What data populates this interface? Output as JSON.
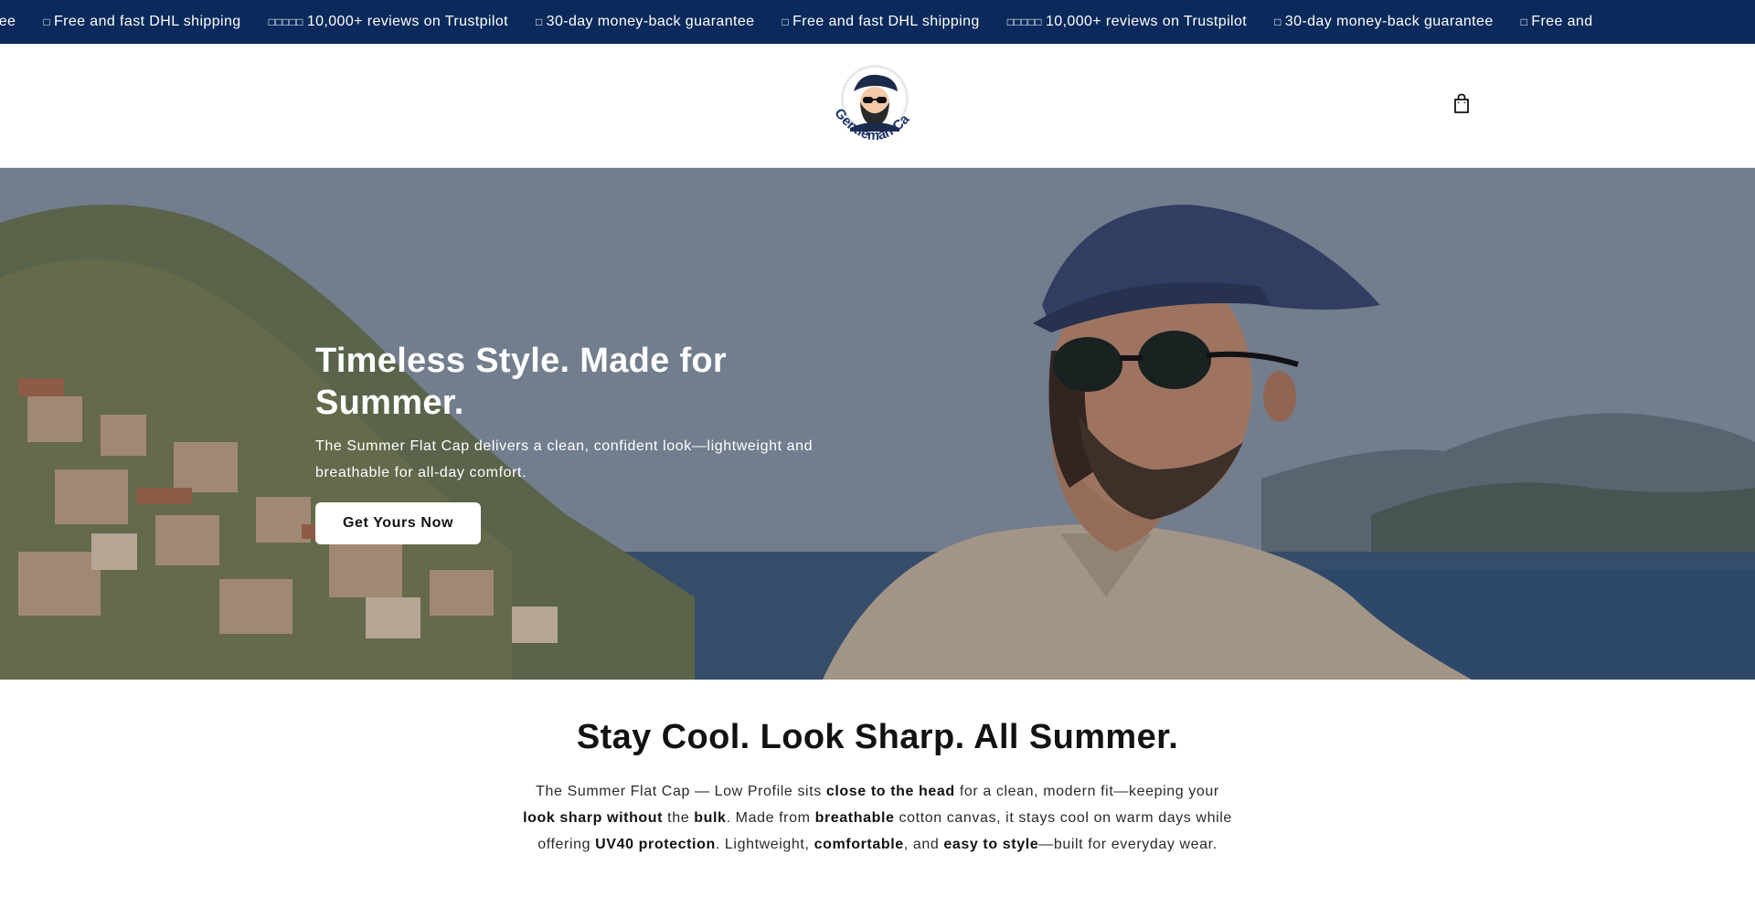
{
  "announcement": {
    "items": [
      {
        "icon": "none",
        "text": "ck guarantee"
      },
      {
        "icon": "truck-icon",
        "text": "Free and fast DHL shipping"
      },
      {
        "icon": "stars-icon",
        "text": "10,000+ reviews on Trustpilot"
      },
      {
        "icon": "shield-icon",
        "text": "30-day money-back guarantee"
      },
      {
        "icon": "truck-icon",
        "text": "Free and fast DHL shipping"
      },
      {
        "icon": "stars-icon",
        "text": "10,000+ reviews on Trustpilot"
      },
      {
        "icon": "shield-icon",
        "text": "30-day money-back guarantee"
      },
      {
        "icon": "truck-icon",
        "text": "Free and"
      }
    ],
    "background": "#0b2a5b"
  },
  "header": {
    "logo_text": "Gentleman Cap",
    "cart_icon": "shopping-bag-icon"
  },
  "hero": {
    "title": "Timeless Style. Made for Summer.",
    "subtitle": "The Summer Flat Cap delivers a clean, confident look—lightweight and breathable for all-day comfort.",
    "cta_label": "Get Yours Now"
  },
  "section": {
    "title": "Stay Cool. Look Sharp. All Summer.",
    "body": [
      {
        "t": "The Summer Flat Cap — Low Profile sits ",
        "b": false
      },
      {
        "t": "close to the head",
        "b": true
      },
      {
        "t": " for a clean, modern fit—keeping your ",
        "b": false
      },
      {
        "t": "look sharp without",
        "b": true
      },
      {
        "t": " the ",
        "b": false
      },
      {
        "t": "bulk",
        "b": true
      },
      {
        "t": ". Made from ",
        "b": false
      },
      {
        "t": "breathable",
        "b": true
      },
      {
        "t": " cotton canvas, it stays cool on warm days while offering ",
        "b": false
      },
      {
        "t": "UV40 protection",
        "b": true
      },
      {
        "t": ". Lightweight, ",
        "b": false
      },
      {
        "t": "comfortable",
        "b": true
      },
      {
        "t": ", and ",
        "b": false
      },
      {
        "t": "easy to style",
        "b": true
      },
      {
        "t": "—built for everyday wear.",
        "b": false
      }
    ]
  }
}
